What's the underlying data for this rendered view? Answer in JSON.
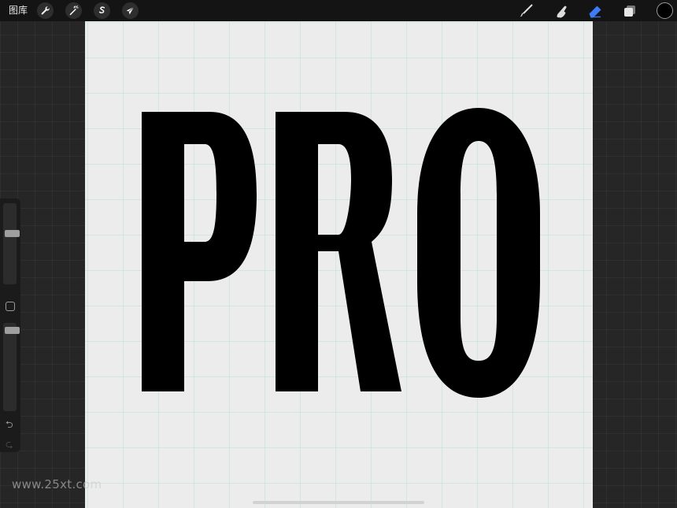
{
  "topbar": {
    "gallery_label": "图库",
    "left_tools": [
      {
        "name": "actions",
        "icon": "wrench-icon"
      },
      {
        "name": "adjustments",
        "icon": "magic-wand-icon"
      },
      {
        "name": "selection",
        "icon": "selection-s-icon"
      },
      {
        "name": "transform",
        "icon": "arrow-cursor-icon"
      }
    ],
    "right_tools": [
      {
        "name": "brush",
        "icon": "brush-icon"
      },
      {
        "name": "smudge",
        "icon": "smudge-finger-icon"
      },
      {
        "name": "eraser",
        "icon": "eraser-icon",
        "active": true
      },
      {
        "name": "layers",
        "icon": "layers-icon"
      }
    ],
    "current_color": "#000000",
    "accent_color": "#3d7bf7"
  },
  "canvas": {
    "background": "#ececec",
    "grid_color": "#9fd6c8",
    "artwork_text": "PRO",
    "artwork_color": "#000000"
  },
  "sidebar": {
    "brush_size_level": 0.64,
    "opacity_level": 0.95,
    "undo_icon": "undo-arrow-icon",
    "redo_icon": "redo-arrow-icon"
  },
  "watermark": "www.25xt.com"
}
